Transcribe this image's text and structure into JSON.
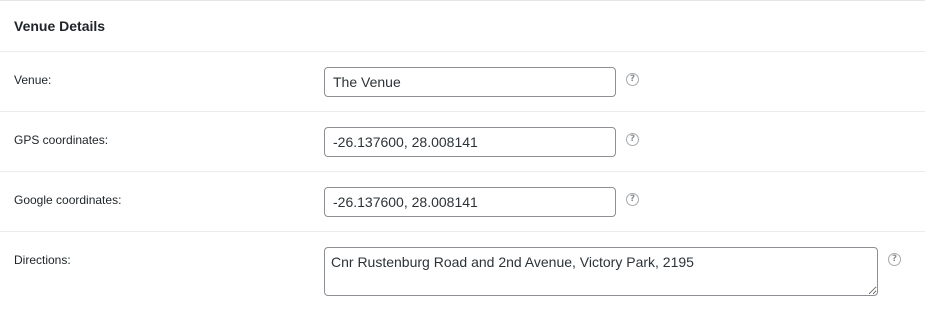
{
  "section": {
    "title": "Venue Details"
  },
  "fields": [
    {
      "label": "Venue:",
      "value": "The Venue",
      "help_icon": "help-icon"
    },
    {
      "label": "GPS coordinates:",
      "value": "-26.137600, 28.008141",
      "help_icon": "help-icon"
    },
    {
      "label": "Google coordinates:",
      "value": "-26.137600, 28.008141",
      "help_icon": "help-icon"
    },
    {
      "label": "Directions:",
      "value": "Cnr Rustenburg Road and 2nd Avenue, Victory Park, 2195",
      "help_icon": "help-icon"
    }
  ],
  "help_glyph": "?",
  "colors": {
    "border": "#8c8f94",
    "divider": "#ececec",
    "text": "#1d2327",
    "help_icon": "#a7aaad"
  }
}
